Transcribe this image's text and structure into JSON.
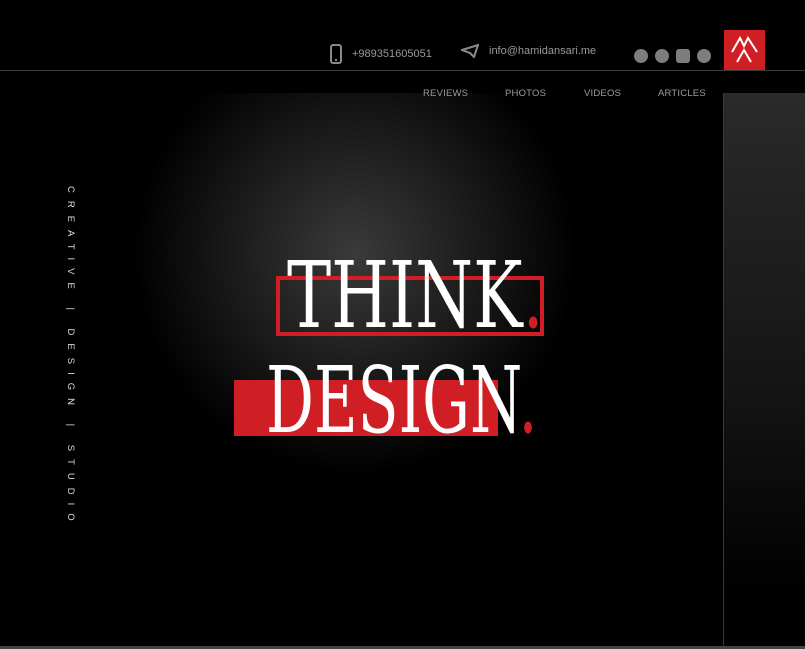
{
  "header": {
    "phone": "+989351605051",
    "email": "info@hamidansari.me",
    "phone_icon": "phone-icon",
    "email_icon": "telegram-send-icon",
    "social": [
      "telegram-icon",
      "pinterest-icon",
      "instagram-icon",
      "facebook-icon"
    ]
  },
  "nav": {
    "items": [
      "REVIEWS",
      "PHOTOS",
      "VIDEOS",
      "ARTICLES"
    ]
  },
  "sidebar": {
    "tagline": "CREATIVE | DESIGN | STUDIO"
  },
  "hero": {
    "line1": "THINK",
    "line2": "DESIGN",
    "dot": "."
  },
  "colors": {
    "accent": "#d01f24",
    "background": "#000000"
  }
}
